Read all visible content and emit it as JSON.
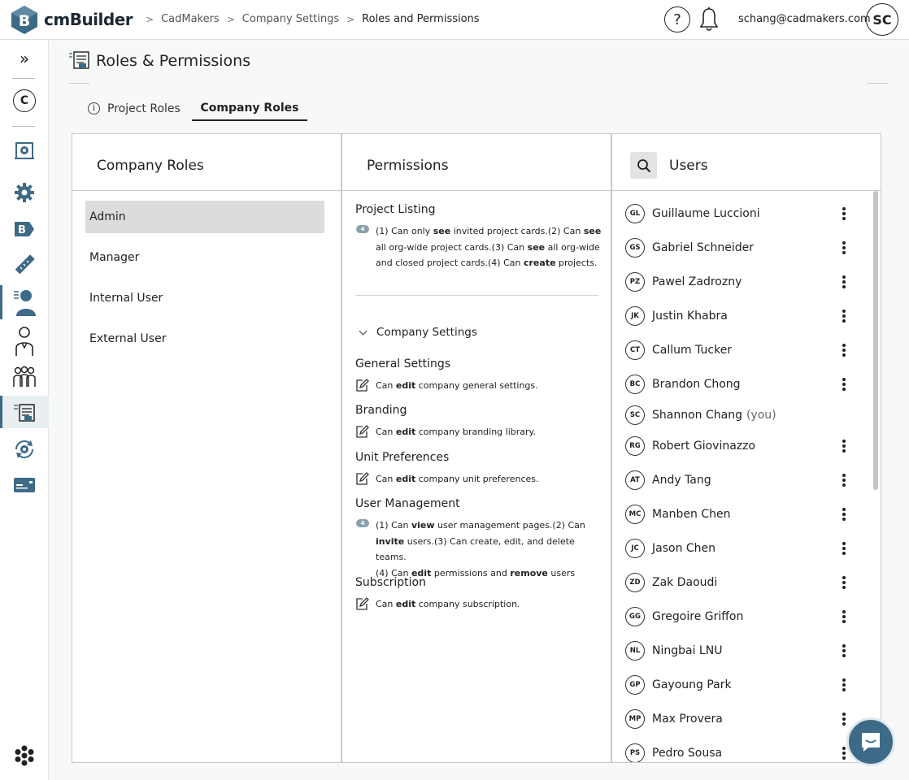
{
  "app": {
    "name": "cmBuilder",
    "logo_letter": "B"
  },
  "breadcrumb": [
    "CadMakers",
    "Company Settings",
    "Roles and Permissions"
  ],
  "header": {
    "user_email": "schang@cadmakers.com",
    "user_initials": "SC",
    "help": "?"
  },
  "rail": {
    "expand": "»",
    "company_letter": "C"
  },
  "page": {
    "title": "Roles & Permissions"
  },
  "tabs": [
    {
      "label": "Project Roles"
    },
    {
      "label": "Company Roles"
    }
  ],
  "roles": {
    "title": "Company Roles",
    "items": [
      "Admin",
      "Manager",
      "Internal User",
      "External User"
    ],
    "selected": "Admin"
  },
  "permissions": {
    "title": "Permissions",
    "project_listing": {
      "title": "Project Listing",
      "badge": "4",
      "lines": [
        "(1) Can only <b>see</b> invited project cards.(2) Can <b>see</b>",
        "all org-wide project cards.(3) Can <b>see</b> all org-wide",
        "and closed project cards.(4) Can <b>create</b> projects."
      ]
    },
    "group_label": "Company Settings",
    "sections": [
      {
        "title": "General Settings",
        "text": "Can <b>edit</b> company general settings."
      },
      {
        "title": "Branding",
        "text": "Can <b>edit</b> company branding library."
      },
      {
        "title": "Unit Preferences",
        "text": "Can <b>edit</b> company unit preferences."
      }
    ],
    "user_management": {
      "title": "User Management",
      "badge": "4",
      "lines": [
        "(1) Can <b>view</b> user management pages.(2) Can",
        "<b>invite</b> users.(3) Can create, edit, and delete teams.",
        "(4) Can <b>edit</b> permissions and <b>remove</b> users"
      ]
    },
    "subscription": {
      "title": "Subscription",
      "text": "Can <b>edit</b> company subscription."
    }
  },
  "users": {
    "title": "Users",
    "you_label": "(you)",
    "list": [
      {
        "initials": "GL",
        "name": "Guillaume Luccioni",
        "menu": true
      },
      {
        "initials": "GS",
        "name": "Gabriel Schneider",
        "menu": true
      },
      {
        "initials": "PZ",
        "name": "Pawel Zadrozny",
        "menu": true
      },
      {
        "initials": "JK",
        "name": "Justin Khabra",
        "menu": true
      },
      {
        "initials": "CT",
        "name": "Callum Tucker",
        "menu": true
      },
      {
        "initials": "BC",
        "name": "Brandon Chong",
        "menu": true
      },
      {
        "initials": "SC",
        "name": "Shannon Chang",
        "you": true,
        "menu": false
      },
      {
        "initials": "RG",
        "name": "Robert Giovinazzo",
        "menu": true
      },
      {
        "initials": "AT",
        "name": "Andy Tang",
        "menu": true
      },
      {
        "initials": "MC",
        "name": "Manben Chen",
        "menu": true
      },
      {
        "initials": "JC",
        "name": "Jason Chen",
        "menu": true
      },
      {
        "initials": "ZD",
        "name": "Zak Daoudi",
        "menu": true
      },
      {
        "initials": "GG",
        "name": "Gregoire Griffon",
        "menu": true
      },
      {
        "initials": "NL",
        "name": "Ningbai LNU",
        "menu": true
      },
      {
        "initials": "GP",
        "name": "Gayoung Park",
        "menu": true
      },
      {
        "initials": "MP",
        "name": "Max Provera",
        "menu": true
      },
      {
        "initials": "PS",
        "name": "Pedro Sousa",
        "menu": true
      }
    ]
  },
  "colors": {
    "accent": "#3d6a86",
    "selected_bg": "#dcdcdc"
  }
}
